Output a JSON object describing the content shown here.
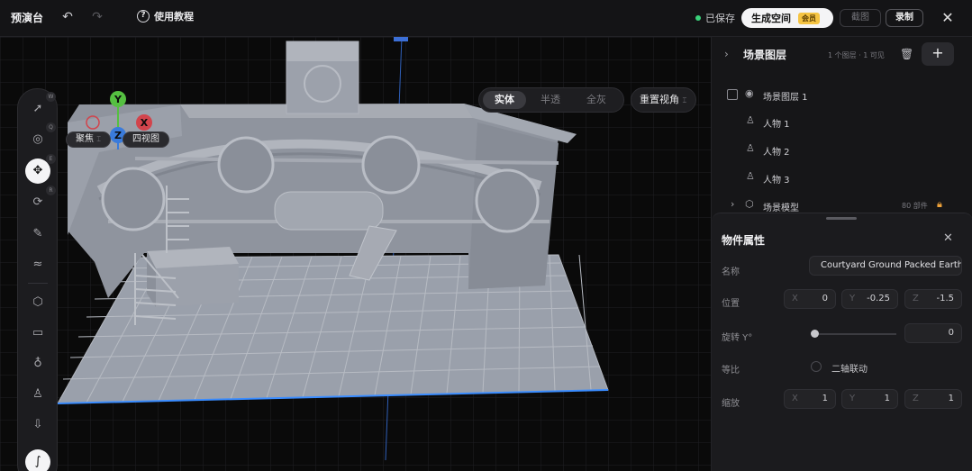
{
  "topbar": {
    "title": "预演台",
    "help_label": "使用教程",
    "saved_label": "已保存",
    "generate_label": "生成空间",
    "vip_badge": "会员",
    "screenshot_label": "截图",
    "record_label": "录制"
  },
  "viewport": {
    "focus_label": "聚焦",
    "four_view_label": "四视图",
    "view_modes": [
      "实体",
      "半透",
      "全灰"
    ],
    "active_mode": "实体",
    "reset_view_label": "重置视角",
    "gizmo": {
      "y": "Y",
      "z": "Z",
      "x": "X"
    },
    "tool_keys": [
      "W",
      "Q",
      "E",
      "R"
    ]
  },
  "layers": {
    "title": "场景图层",
    "count_text": "1 个图层 · 1 可见",
    "items": [
      {
        "label": "场景图层 1"
      },
      {
        "label": "人物 1"
      },
      {
        "label": "人物 2"
      },
      {
        "label": "人物 3"
      },
      {
        "label": "场景模型",
        "meta": "80 部件"
      }
    ]
  },
  "properties": {
    "title": "物件属性",
    "name_label": "名称",
    "name_value": "Courtyard Ground Packed Earth",
    "position_label": "位置",
    "position": {
      "x": "0",
      "y": "-0.25",
      "z": "-1.5"
    },
    "rotation_label": "旋转 Y°",
    "rotation_value": "0",
    "ratio_label": "等比",
    "link_label": "二轴联动",
    "scale_label": "缩放",
    "scale": {
      "x": "1",
      "y": "1",
      "z": "1"
    },
    "axis_x": "X",
    "axis_y": "Y",
    "axis_z": "Z"
  },
  "colors": {
    "accent_green": "#3ad27a",
    "vip_gold": "#f5c443",
    "lock_orange": "#f0a33a",
    "model_grey": "#9aa0ab"
  }
}
